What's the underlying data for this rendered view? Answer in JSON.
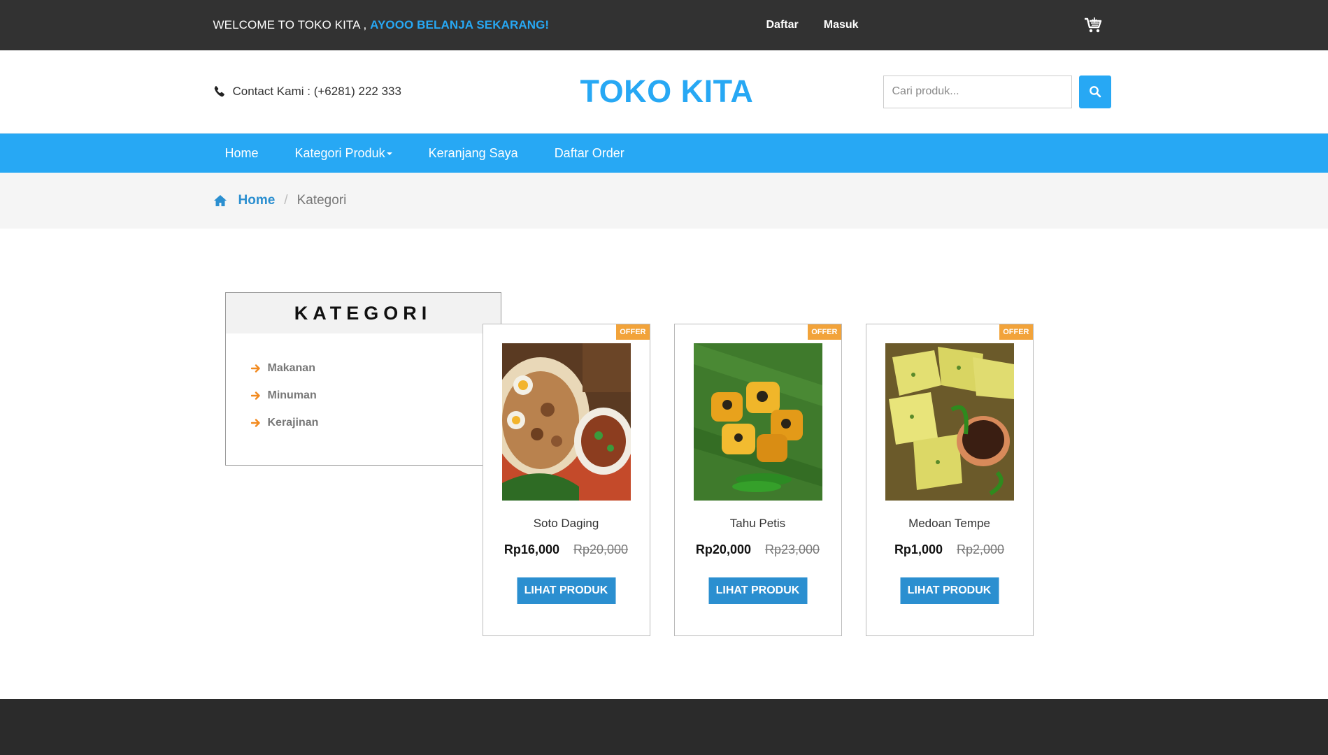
{
  "topbar": {
    "welcome": "WELCOME TO TOKO KITA ,",
    "welcome_highlight": "AYOOO BELANJA SEKARANG!",
    "daftar": "Daftar",
    "masuk": "Masuk"
  },
  "header": {
    "contact": "Contact Kami : (+6281) 222 333",
    "logo": "TOKO KITA",
    "search_placeholder": "Cari produk..."
  },
  "nav": {
    "home": "Home",
    "kategori": "Kategori Produk",
    "keranjang": "Keranjang Saya",
    "order": "Daftar Order"
  },
  "breadcrumb": {
    "home": "Home",
    "sep": "/",
    "current": "Kategori"
  },
  "sidebar": {
    "title": "KATEGORI",
    "items": [
      "Makanan",
      "Minuman",
      "Kerajinan"
    ]
  },
  "products": [
    {
      "badge": "OFFER",
      "name": "Soto Daging",
      "price": "Rp16,000",
      "old_price": "Rp20,000",
      "button": "LIHAT PRODUK"
    },
    {
      "badge": "OFFER",
      "name": "Tahu Petis",
      "price": "Rp20,000",
      "old_price": "Rp23,000",
      "button": "LIHAT PRODUK"
    },
    {
      "badge": "OFFER",
      "name": "Medoan Tempe",
      "price": "Rp1,000",
      "old_price": "Rp2,000",
      "button": "LIHAT PRODUK"
    }
  ],
  "colors": {
    "brand": "#27a8f4",
    "dark": "#323232",
    "offer": "#f2a33a",
    "button": "#2b8fd0"
  }
}
